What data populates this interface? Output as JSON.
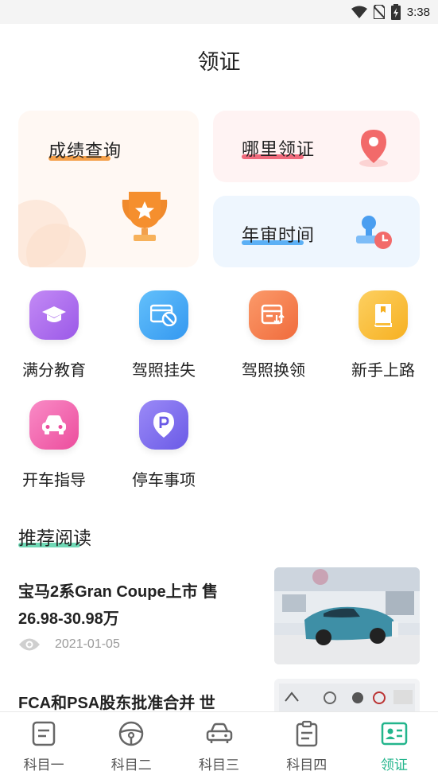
{
  "status_bar": {
    "time": "3:38"
  },
  "page_title": "领证",
  "cards": {
    "score": "成绩查询",
    "where": "哪里领证",
    "audit": "年审时间"
  },
  "grid": [
    {
      "label": "满分教育",
      "icon": "graduation-cap-icon"
    },
    {
      "label": "驾照挂失",
      "icon": "card-cancel-icon"
    },
    {
      "label": "驾照换领",
      "icon": "card-renew-icon"
    },
    {
      "label": "新手上路",
      "icon": "book-icon"
    },
    {
      "label": "开车指导",
      "icon": "car-icon"
    },
    {
      "label": "停车事项",
      "icon": "parking-icon"
    }
  ],
  "recommended": {
    "title": "推荐阅读",
    "articles": [
      {
        "title": "宝马2系Gran Coupe上市 售26.98-30.98万",
        "date": "2021-01-05"
      },
      {
        "title": "FCA和PSA股东批准合并 世",
        "date": ""
      }
    ]
  },
  "bottom_nav": [
    {
      "label": "科目一",
      "icon": "document-icon"
    },
    {
      "label": "科目二",
      "icon": "steering-wheel-icon"
    },
    {
      "label": "科目三",
      "icon": "car-icon"
    },
    {
      "label": "科目四",
      "icon": "notepad-icon"
    },
    {
      "label": "领证",
      "icon": "license-card-icon",
      "active": true
    }
  ],
  "colors": {
    "accent": "#23b58c",
    "score_underline": "#f5a04a",
    "where_underline": "#f06a7c",
    "audit_underline": "#5cb0f5"
  }
}
